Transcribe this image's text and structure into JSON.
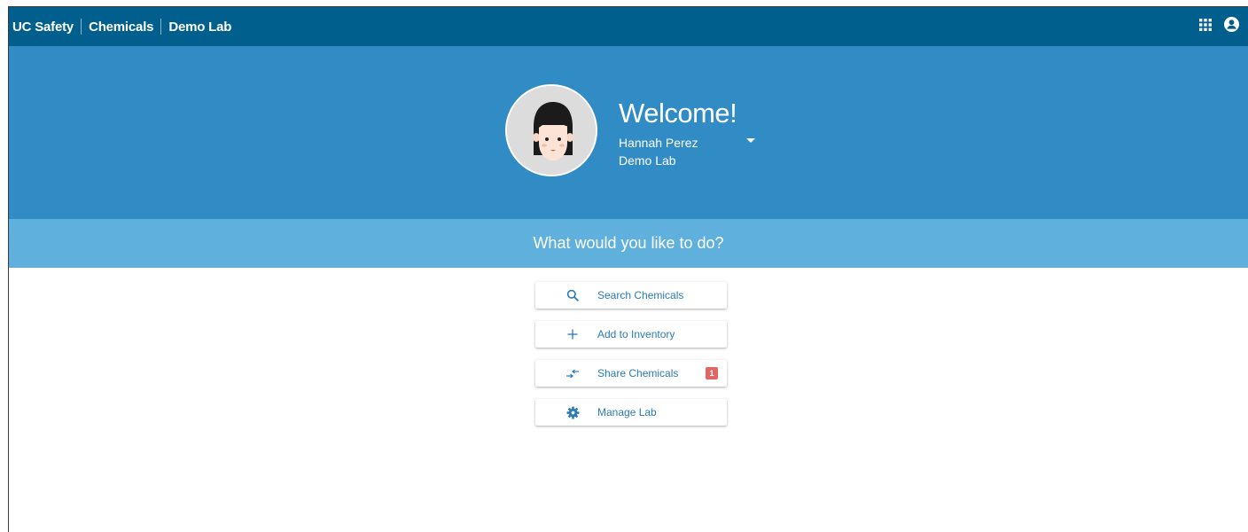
{
  "header": {
    "breadcrumbs": [
      "UC Safety",
      "Chemicals",
      "Demo Lab"
    ],
    "icons": [
      "apps-grid-icon",
      "user-account-icon"
    ]
  },
  "hero": {
    "welcome": "Welcome!",
    "user_name": "Hannah Perez",
    "lab_name": "Demo Lab"
  },
  "prompt": "What would you like to do?",
  "actions": [
    {
      "label": "Search Chemicals",
      "icon": "search-icon"
    },
    {
      "label": "Add to Inventory",
      "icon": "plus-icon"
    },
    {
      "label": "Share Chemicals",
      "icon": "share-arrows-icon",
      "badge": "1"
    },
    {
      "label": "Manage Lab",
      "icon": "gear-icon"
    }
  ],
  "colors": {
    "topbar": "#005f8d",
    "hero": "#318bc4",
    "prompt_bar": "#5fb0dc",
    "link": "#2a7ab5",
    "badge": "#e06666"
  }
}
